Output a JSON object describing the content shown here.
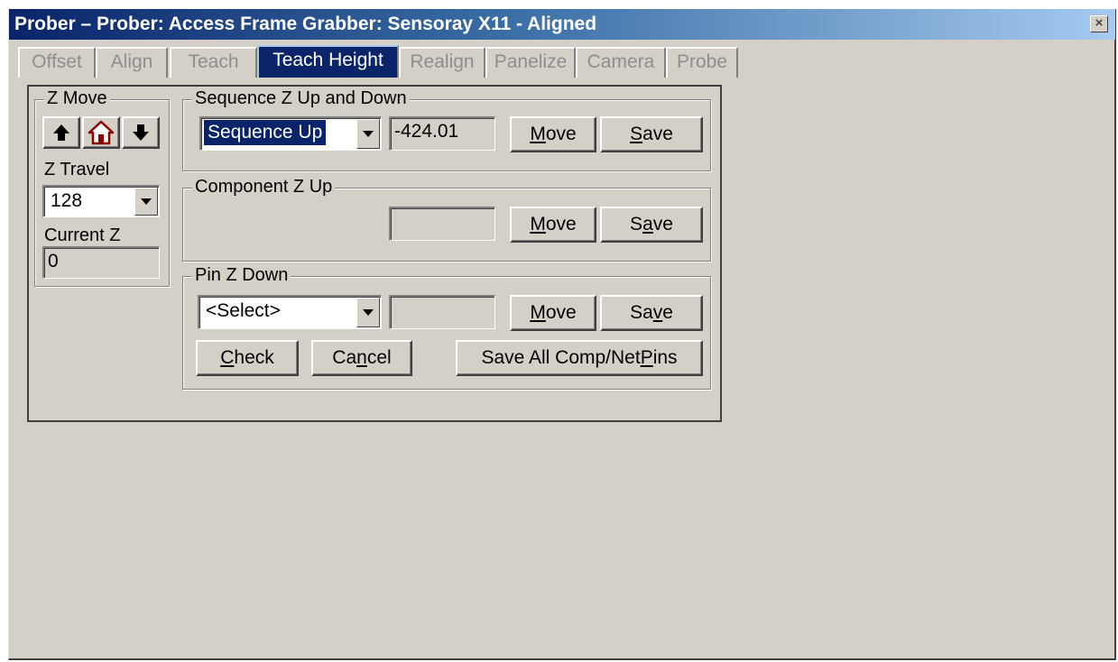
{
  "window": {
    "title": "Prober – Prober: Access Frame Grabber: Sensoray X11 - Aligned",
    "close_label": "×"
  },
  "tabs": [
    {
      "label": "Offset",
      "active": false
    },
    {
      "label": "Align",
      "active": false
    },
    {
      "label": "Teach",
      "active": false
    },
    {
      "label": "Teach Height",
      "active": true
    },
    {
      "label": "Realign",
      "active": false
    },
    {
      "label": "Panelize",
      "active": false
    },
    {
      "label": "Camera",
      "active": false
    },
    {
      "label": "Probe",
      "active": false
    }
  ],
  "z_move": {
    "title": "Z Move",
    "up_icon": "arrow-up-icon",
    "home_icon": "home-icon",
    "down_icon": "arrow-down-icon",
    "travel_label": "Z Travel",
    "travel_value": "128",
    "current_label": "Current Z",
    "current_value": "0"
  },
  "sequence": {
    "title": "Sequence Z Up and Down",
    "select_value": "Sequence Up",
    "value": "-424.01",
    "move_pre": "",
    "move_key": "M",
    "move_post": "ove",
    "save_pre": "",
    "save_key": "S",
    "save_post": "ave"
  },
  "component": {
    "title": "Component Z Up",
    "value": "",
    "move_pre": "",
    "move_key": "M",
    "move_post": "ove",
    "save_pre": "S",
    "save_key": "a",
    "save_post": "ve"
  },
  "pin": {
    "title": "Pin Z Down",
    "select_value": "<Select>",
    "value": "",
    "move_pre": "",
    "move_key": "M",
    "move_post": "ove",
    "save_pre": "Sa",
    "save_key": "v",
    "save_post": "e",
    "check_pre": "",
    "check_key": "C",
    "check_post": "heck",
    "cancel_pre": "Ca",
    "cancel_key": "n",
    "cancel_post": "cel",
    "saveall_pre": "Save All Comp/Net ",
    "saveall_key": "P",
    "saveall_post": "ins"
  },
  "colors": {
    "face": "#d4d0c8",
    "title_start": "#0a246a",
    "title_end": "#a6caf0",
    "selection": "#0a246a"
  }
}
